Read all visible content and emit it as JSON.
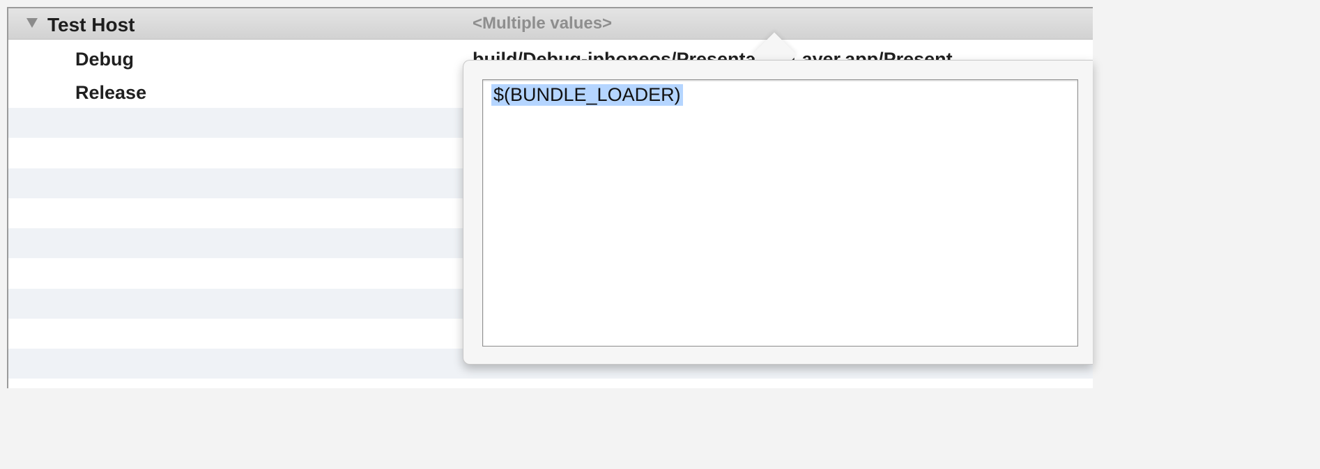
{
  "group": {
    "title": "Test Host",
    "value": "<Multiple values>"
  },
  "rows": [
    {
      "label": "Debug",
      "value": "build/Debug-iphoneos/PresentationLayer.app/Present"
    },
    {
      "label": "Release",
      "value": ""
    }
  ],
  "editor": {
    "value": "$(BUNDLE_LOADER)",
    "selected": true
  },
  "icons": {
    "disclosure": "disclosure-triangle-expanded-icon"
  },
  "colors": {
    "selection": "#b5d5ff",
    "header": "#d8d8d8",
    "stripe": "#eff2f6",
    "placeholder_text": "#8e8e8e"
  }
}
